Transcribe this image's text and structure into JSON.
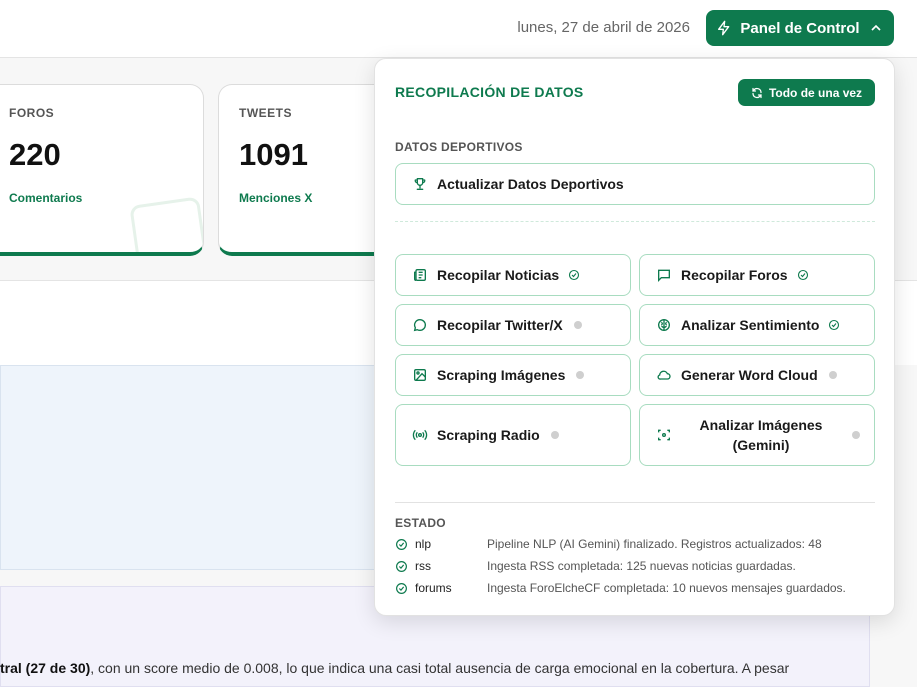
{
  "header": {
    "date": "lunes, 27 de abril de 2026",
    "panel_button": "Panel de Control"
  },
  "cards": [
    {
      "label": "FOROS",
      "value": "220",
      "sub": "Comentarios"
    },
    {
      "label": "TWEETS",
      "value": "1091",
      "sub": "Menciones X"
    }
  ],
  "paragraph": {
    "bold": "tral (27 de 30)",
    "text": ", con un score medio de 0.008, lo que indica una casi total ausencia de carga emocional en la cobertura. A pesar"
  },
  "dropdown": {
    "title": "RECOPILACIÓN DE DATOS",
    "all_button": "Todo de una vez",
    "sports_label": "DATOS DEPORTIVOS",
    "sports_button": "Actualizar Datos Deportivos",
    "actions": [
      {
        "label": "Recopilar Noticias",
        "icon": "newspaper-icon",
        "status": "done"
      },
      {
        "label": "Recopilar Foros",
        "icon": "message-square-icon",
        "status": "done"
      },
      {
        "label": "Recopilar Twitter/X",
        "icon": "message-circle-icon",
        "status": "idle"
      },
      {
        "label": "Analizar Sentimiento",
        "icon": "brain-icon",
        "status": "done"
      },
      {
        "label": "Scraping Imágenes",
        "icon": "image-icon",
        "status": "idle"
      },
      {
        "label": "Generar Word Cloud",
        "icon": "cloud-icon",
        "status": "idle"
      },
      {
        "label": "Scraping Radio",
        "icon": "radio-icon",
        "status": "idle"
      },
      {
        "label": "Analizar Imágenes (Gemini)",
        "icon": "scan-eye-icon",
        "status": "idle"
      }
    ],
    "status_label": "ESTADO",
    "status": [
      {
        "key": "nlp",
        "message": "Pipeline NLP (AI Gemini) finalizado. Registros actualizados: 48"
      },
      {
        "key": "rss",
        "message": "Ingesta RSS completada: 125 nuevas noticias guardadas."
      },
      {
        "key": "forums",
        "message": "Ingesta ForoElcheCF completada: 10 nuevos mensajes guardados."
      }
    ]
  },
  "colors": {
    "accent": "#0e7a4e",
    "accent_border": "#a8dcc0",
    "idle_dot": "#cfcfcf"
  }
}
